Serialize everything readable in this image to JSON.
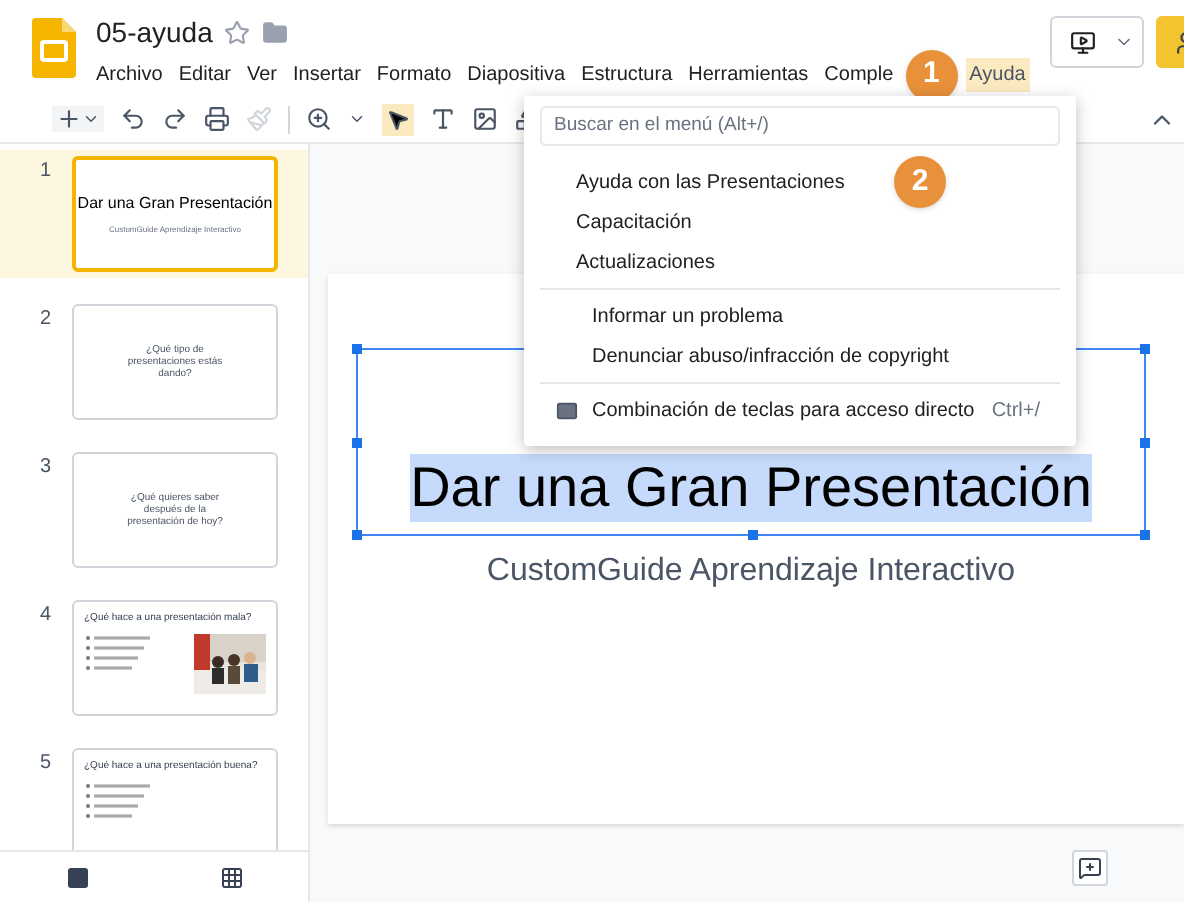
{
  "document": {
    "title": "05-ayuda",
    "starred": false
  },
  "menu_bar": [
    {
      "label": "Archivo",
      "selected": false
    },
    {
      "label": "Editar",
      "selected": false
    },
    {
      "label": "Ver",
      "selected": false
    },
    {
      "label": "Insertar",
      "selected": false
    },
    {
      "label": "Formato",
      "selected": false
    },
    {
      "label": "Diapositiva",
      "selected": false
    },
    {
      "label": "Estructura",
      "selected": false
    },
    {
      "label": "Herramientas",
      "selected": false
    },
    {
      "label": "Comple",
      "selected": false
    },
    {
      "label": "Ayuda",
      "selected": true
    }
  ],
  "callouts": [
    "1",
    "2"
  ],
  "help_menu": {
    "search": {
      "placeholder": "Buscar en el menú (Alt+/)"
    },
    "sections": [
      [
        {
          "label": "Ayuda con las Presentaciones"
        },
        {
          "label": "Capacitación"
        },
        {
          "label": "Actualizaciones"
        }
      ],
      [
        {
          "label": "Informar un problema"
        },
        {
          "label": "Denunciar abuso/infracción de copyright"
        }
      ],
      [
        {
          "label": "Combinación de teclas para acceso directo",
          "shortcut": "Ctrl+/",
          "kind": "keyboard"
        }
      ]
    ]
  },
  "slides": [
    {
      "number": "1",
      "kind": "title",
      "title": "Dar una Gran Presentación",
      "subtitle": "CustomGuide Aprendizaje Interactivo",
      "selected": true
    },
    {
      "number": "2",
      "kind": "question",
      "title": "¿Qué tipo de presentaciones estás dando?",
      "selected": false
    },
    {
      "number": "3",
      "kind": "question",
      "title": "¿Qué quieres saber después de la presentación de hoy?",
      "selected": false
    },
    {
      "number": "4",
      "kind": "bullets_photo",
      "title": "¿Qué hace a una presentación mala?",
      "selected": false
    },
    {
      "number": "5",
      "kind": "bullets",
      "title": "¿Qué hace a una presentación buena?",
      "selected": false
    }
  ],
  "canvas": {
    "title": "Dar una Gran Presentación",
    "subtitle": "CustomGuide Aprendizaje Interactivo",
    "title_selected": true
  }
}
